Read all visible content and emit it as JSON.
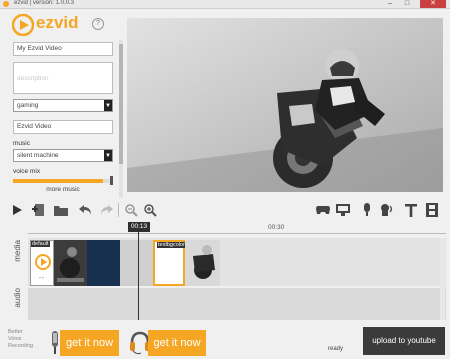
{
  "window": {
    "title": "ezvid | version: 1.0.0.3",
    "minimize": "–",
    "maximize": "□",
    "close": "✕"
  },
  "logo": {
    "text": "ezvid",
    "help": "?"
  },
  "form": {
    "title_value": "My Ezvid Video",
    "description_placeholder": "description",
    "category_value": "gaming",
    "author_value": "Ezvid Video",
    "music_label": "music",
    "music_value": "silent machine",
    "voice_mix_label": "voice mix",
    "voice_mix_level": 0.9,
    "more_music": "more music"
  },
  "timeline": {
    "playhead_time": "00:13",
    "ruler_mark": "00:30",
    "media_label": "media",
    "audio_label": "audio",
    "clip1_label": "default",
    "clip2_label": "textbgcolor",
    "clip1_sub": "\" \""
  },
  "footer": {
    "promo_lines": [
      "Better",
      "Voice",
      "Recording"
    ],
    "get_it_now_1": "get it now",
    "get_it_now_2": "get it now",
    "status": "ready",
    "upload": "upload to youtube"
  },
  "colors": {
    "accent": "#f5a623",
    "upload_bg": "#3b3b3b"
  }
}
